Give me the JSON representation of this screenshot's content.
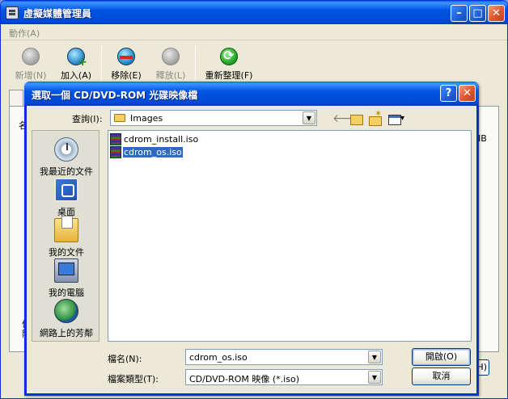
{
  "main_window": {
    "title": "虛擬媒體管理員",
    "menu": {
      "action": "動作(A)"
    },
    "toolbar": {
      "new": "新增(N)",
      "add": "加入(A)",
      "remove": "移除(E)",
      "release": "釋放(L)",
      "refresh": "重新整理(F)"
    },
    "fragments": {
      "col_header": "名",
      "col_header_right": "IB",
      "left_line1": "信",
      "left_line2": "階",
      "right_button": "H)"
    }
  },
  "dialog": {
    "title": "選取一個 CD/DVD-ROM 光碟映像檔",
    "help_glyph": "?",
    "close_glyph": "✕",
    "look_in_label": "查詢(I):",
    "look_in_value": "Images",
    "places": [
      {
        "label": "我最近的文件",
        "icon": "recent-documents-icon"
      },
      {
        "label": "桌面",
        "icon": "desktop-icon"
      },
      {
        "label": "我的文件",
        "icon": "my-documents-icon"
      },
      {
        "label": "我的電腦",
        "icon": "my-computer-icon"
      },
      {
        "label": "網路上的芳鄰",
        "icon": "network-places-icon"
      }
    ],
    "files": [
      {
        "name": "cdrom_install.iso",
        "selected": false
      },
      {
        "name": "cdrom_os.iso",
        "selected": true
      }
    ],
    "filename_label": "檔名(N):",
    "filename_value": "cdrom_os.iso",
    "filetype_label": "檔案類型(T):",
    "filetype_value": "CD/DVD-ROM 映像 (*.iso)",
    "open_button": "開啟(O)",
    "cancel_button": "取消"
  },
  "colors": {
    "titlebar_blue": "#0054e3",
    "window_face": "#ece9d8",
    "selection": "#316ac5",
    "close_red": "#e0552e"
  }
}
